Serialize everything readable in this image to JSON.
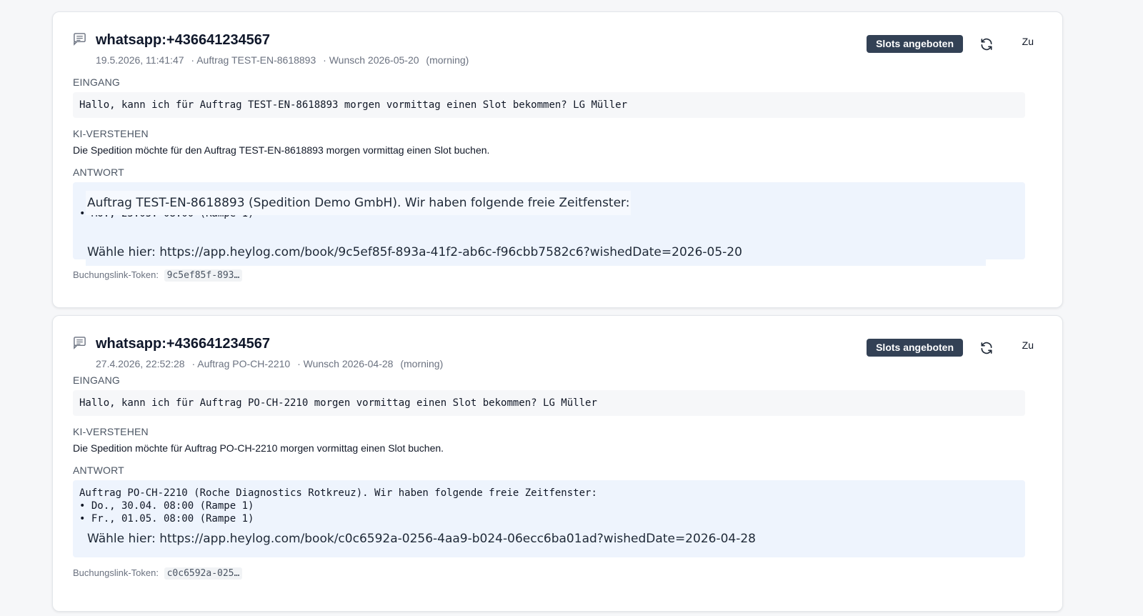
{
  "cards": [
    {
      "title": "whatsapp:+436641234567",
      "timestamp": "19.5.2026, 11:41:47",
      "order": "· Auftrag TEST-EN-8618893",
      "wish": "· Wunsch 2026-05-20",
      "daypart": "(morning)",
      "status_badge": "Slots angeboten",
      "close_label": "Zu",
      "incoming_label": "EINGANG",
      "incoming_text": "Hallo, kann ich für Auftrag TEST-EN-8618893 morgen vormittag einen Slot bekommen? LG Müller",
      "understanding_label": "KI-VERSTEHEN",
      "understanding_text": "Die Spedition möchte für den Auftrag TEST-EN-8618893 morgen vormittag einen Slot buchen.",
      "reply_label": "ANTWORT",
      "reply_lines": [
        "Auftrag TEST-EN-8618893 (Spedition Demo GmbH). Wir haben folgende freie Zeitfenster:",
        "• Mo., 25.05. 08:00 (Rampe 1)",
        "Wähle hier: https://app.heylog.com/book/9c5ef85f-893a-41f2-ab6c-f96cbb7582c6?wishedDate=2026-05-20"
      ],
      "token_label": "Buchungslink-Token:",
      "token_value": "9c5ef85f-893…"
    },
    {
      "title": "whatsapp:+436641234567",
      "timestamp": "27.4.2026, 22:52:28",
      "order": "· Auftrag PO-CH-2210",
      "wish": "· Wunsch 2026-04-28",
      "daypart": "(morning)",
      "status_badge": "Slots angeboten",
      "close_label": "Zu",
      "incoming_label": "EINGANG",
      "incoming_text": "Hallo, kann ich für Auftrag PO-CH-2210 morgen vormittag einen Slot bekommen? LG Müller",
      "understanding_label": "KI-VERSTEHEN",
      "understanding_text": "Die Spedition möchte für Auftrag PO-CH-2210 morgen vormittag einen Slot buchen.",
      "reply_label": "ANTWORT",
      "reply_lines": [
        "Auftrag PO-CH-2210 (Roche Diagnostics Rotkreuz). Wir haben folgende freie Zeitfenster:",
        "• Do., 30.04. 08:00 (Rampe 1)",
        "• Fr., 01.05. 08:00 (Rampe 1)",
        "Wähle hier: https://app.heylog.com/book/c0c6592a-0256-4aa9-b024-06ecc6ba01ad?wishedDate=2026-04-28"
      ],
      "token_label": "Buchungslink-Token:",
      "token_value": "c0c6592a-025…"
    }
  ],
  "icons": {
    "message": "message-icon",
    "refresh": "refresh-icon"
  },
  "colors": {
    "badge_bg": "#334155",
    "reply_bg": "#eef4fd",
    "incoming_bg": "#f6f7f9"
  }
}
